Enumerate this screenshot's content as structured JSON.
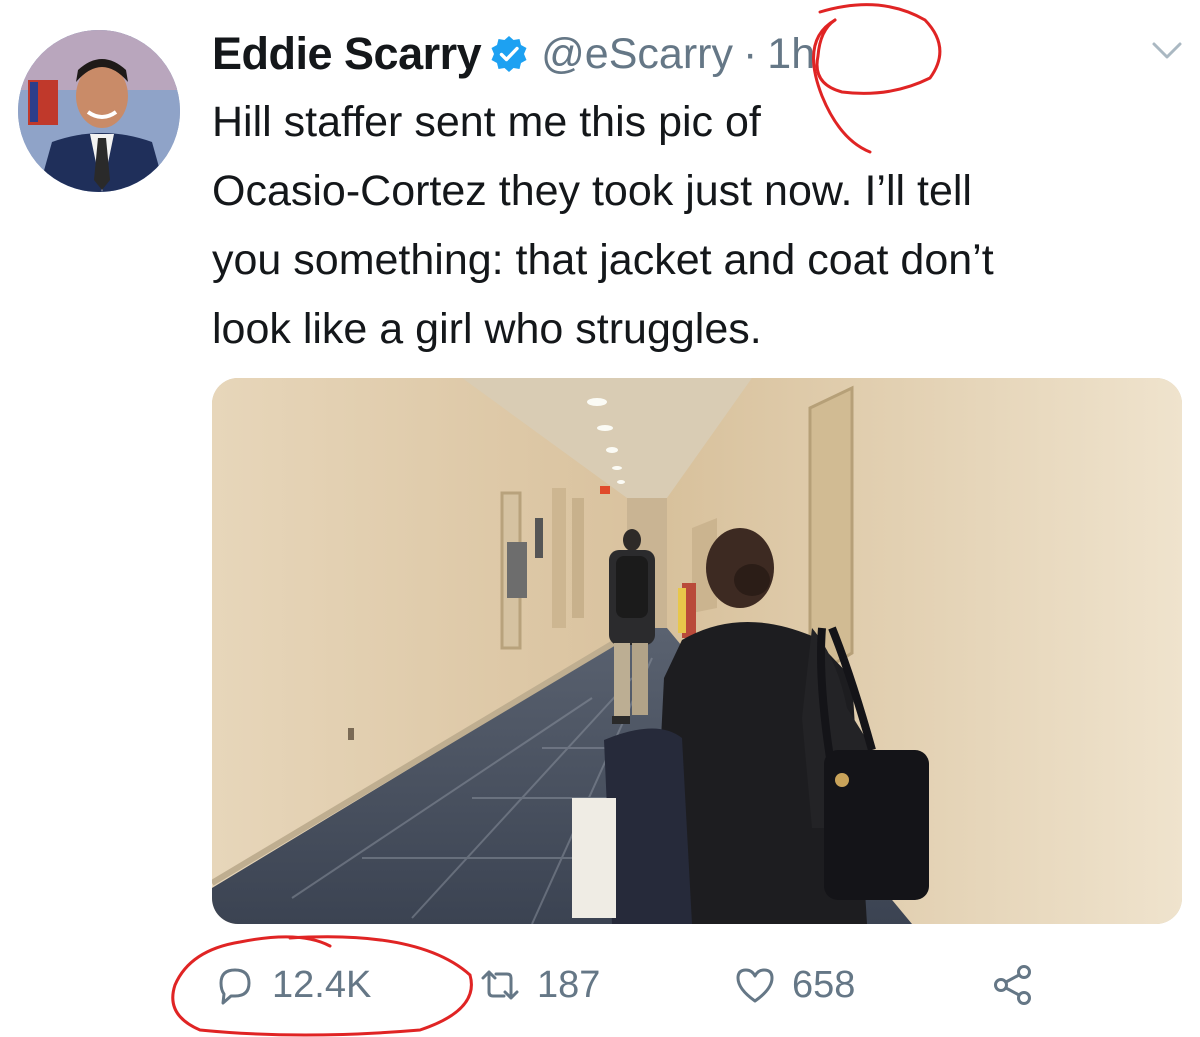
{
  "tweet": {
    "author": {
      "display_name": "Eddie Scarry",
      "handle": "@eScarry",
      "verified": true,
      "avatar": "avatar-photo"
    },
    "separator": "·",
    "time": "1h",
    "text_lines": [
      "Hill staffer sent me this pic of",
      "Ocasio-Cortez they took just now. I’ll tell",
      "you something: that jacket and coat don’t",
      "look like a girl who struggles."
    ],
    "media": "hallway-photo"
  },
  "actions": {
    "reply_count": "12.4K",
    "retweet_count": "187",
    "like_count": "658"
  },
  "icons": {
    "verified": "verified-badge-icon",
    "caret": "chevron-down-icon",
    "reply": "reply-icon",
    "retweet": "retweet-icon",
    "like": "heart-icon",
    "share": "share-icon"
  },
  "colors": {
    "text": "#14171a",
    "secondary": "#657786",
    "verified_blue": "#1da1f2",
    "annotation_red": "#e02424"
  }
}
